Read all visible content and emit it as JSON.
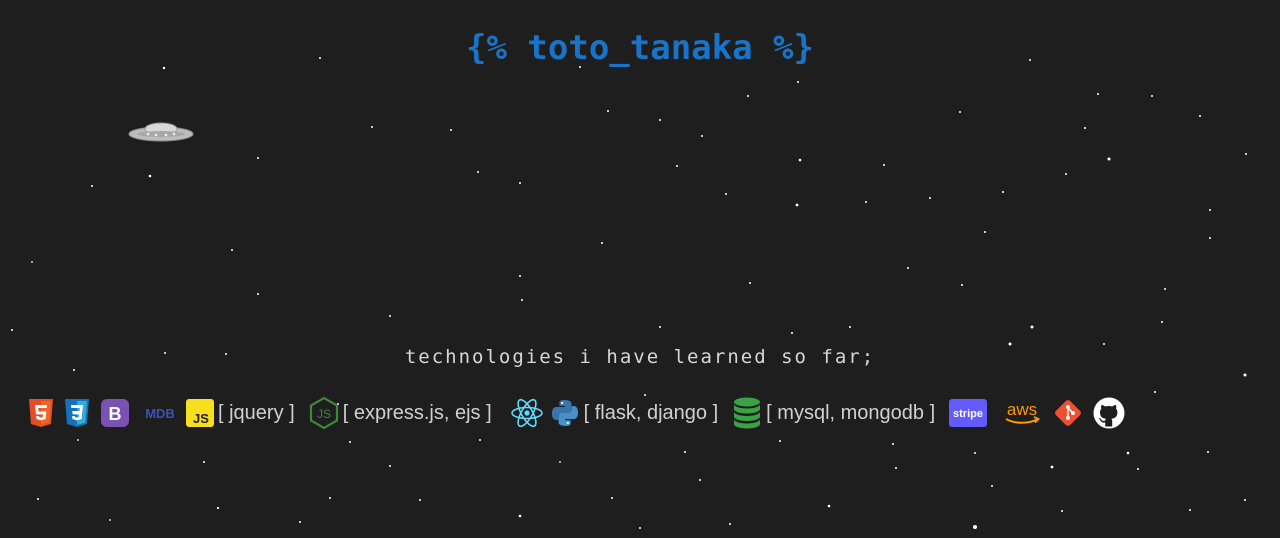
{
  "header": {
    "title": "{% toto_tanaka %}"
  },
  "section": {
    "heading": "technologies i have learned so far;"
  },
  "tech": {
    "icons": [
      "html5-icon",
      "css3-icon",
      "bootstrap-icon",
      "mdb-icon",
      "javascript-icon",
      "nodejs-icon",
      "react-icon",
      "python-icon",
      "database-icon",
      "stripe-icon",
      "aws-icon",
      "git-icon",
      "github-icon"
    ],
    "mdb_text": "MDB",
    "js_text": "JS",
    "jquery_label": "[ jquery ]",
    "node_label": "[ express.js, ejs ]",
    "python_label": "[ flask, django ]",
    "db_label": "[ mysql, mongodb ]",
    "stripe_text": "stripe",
    "aws_text": "aws"
  },
  "colors": {
    "background": "#1e1e1e",
    "title": "#1874c8",
    "html5": "#e44d26",
    "css3": "#1572b6",
    "bootstrap": "#7952b3",
    "mdb": "#3f51b5",
    "javascript": "#f7df1e",
    "nodejs": "#3c873a",
    "react": "#61dafb",
    "python": "#3776ab",
    "database": "#3aa245",
    "stripe": "#635bff",
    "aws": "#ff9900",
    "git": "#f05032"
  }
}
